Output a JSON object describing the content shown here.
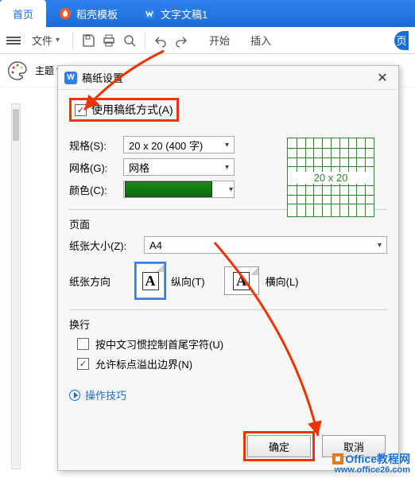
{
  "tabs": {
    "home": "首页",
    "template": "稻壳模板",
    "doc": "文字文稿1"
  },
  "ribbon": {
    "file": "文件",
    "start": "开始",
    "insert": "插入",
    "page": "页"
  },
  "sidebar": {
    "theme": "主题"
  },
  "dialog": {
    "title": "稿纸设置",
    "use_grid": "使用稿纸方式(A)",
    "spec_label": "规格(S):",
    "spec_value": "20 x 20 (400 字)",
    "grid_label": "网格(G):",
    "grid_value": "网格",
    "color_label": "颜色(C):",
    "preview_caption": "20 x 20",
    "page_section": "页面",
    "paper_label": "纸张大小(Z):",
    "paper_value": "A4",
    "orient_label": "纸张方向",
    "portrait": "纵向(T)",
    "landscape": "横向(L)",
    "wrap_section": "换行",
    "wrap_cjk": "按中文习惯控制首尾字符(U)",
    "wrap_punct": "允许标点溢出边界(N)",
    "tips": "操作技巧",
    "ok": "确定",
    "cancel": "取消"
  },
  "watermark": {
    "brand": "Office教程网",
    "url": "www.office26.com"
  }
}
